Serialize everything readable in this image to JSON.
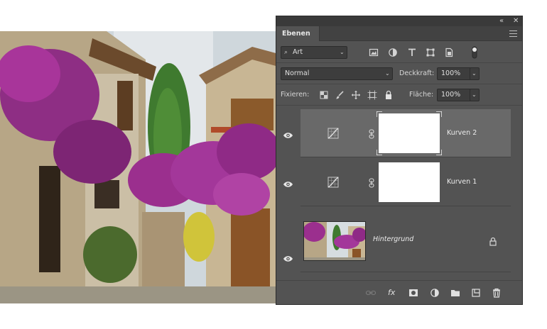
{
  "panel": {
    "collapse_icon": "collapse-panel-icon",
    "close_icon": "close-icon",
    "tab_label": "Ebenen",
    "menu_icon": "panel-menu-icon"
  },
  "filter": {
    "kind_label": "Art",
    "icons": [
      "pixel-filter-icon",
      "adjustment-filter-icon",
      "type-filter-icon",
      "shape-filter-icon",
      "smart-object-filter-icon",
      "filter-toggle-icon"
    ]
  },
  "blend": {
    "mode": "Normal",
    "opacity_label": "Deckkraft:",
    "opacity_value": "100%"
  },
  "lock": {
    "label": "Fixieren:",
    "icons": [
      "lock-transparent-icon",
      "lock-image-icon",
      "lock-position-icon",
      "lock-artboard-icon",
      "lock-all-icon"
    ],
    "fill_label": "Fläche:",
    "fill_value": "100%"
  },
  "layers": [
    {
      "name": "Kurven 2",
      "type": "adjustment",
      "selected": true,
      "visible": true
    },
    {
      "name": "Kurven 1",
      "type": "adjustment",
      "selected": false,
      "visible": true
    },
    {
      "name": "Hintergrund",
      "type": "background",
      "selected": false,
      "visible": true,
      "locked": true
    }
  ],
  "bottom_icons": [
    "link-layers-icon",
    "fx-icon",
    "add-mask-icon",
    "new-adjustment-icon",
    "new-group-icon",
    "new-layer-icon",
    "trash-icon"
  ],
  "bottom_labels": {
    "fx": "fx"
  }
}
